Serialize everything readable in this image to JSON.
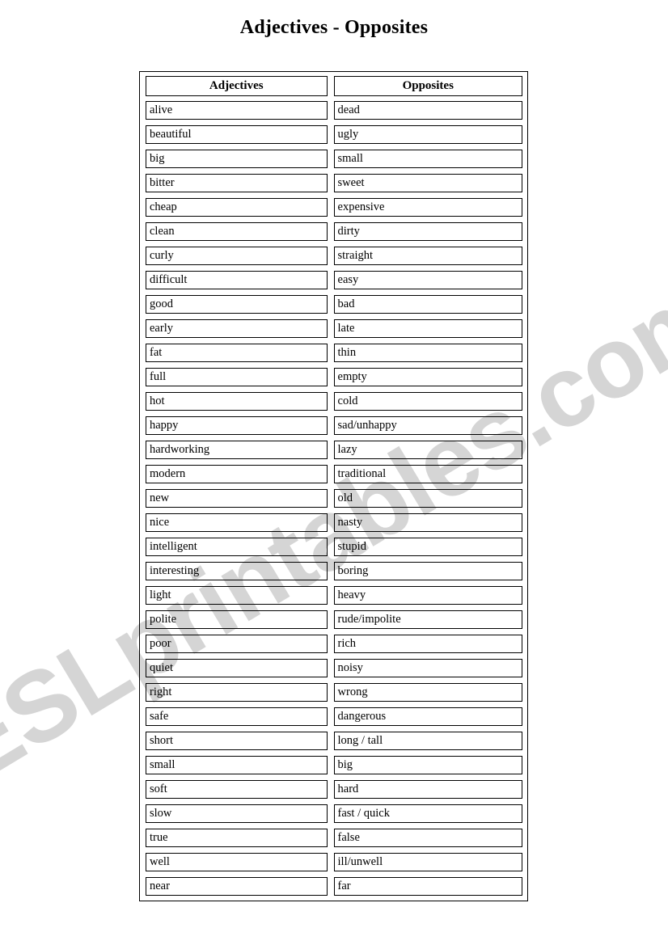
{
  "page": {
    "title": "Adjectives - Opposites"
  },
  "watermark": {
    "text": "ESLprintables.com",
    "color": "#d5d5d5"
  },
  "table": {
    "headers": {
      "left": "Adjectives",
      "right": "Opposites"
    },
    "rows": [
      {
        "adjective": "alive",
        "opposite": "dead"
      },
      {
        "adjective": "beautiful",
        "opposite": "ugly"
      },
      {
        "adjective": "big",
        "opposite": "small"
      },
      {
        "adjective": "bitter",
        "opposite": "sweet"
      },
      {
        "adjective": "cheap",
        "opposite": "expensive"
      },
      {
        "adjective": "clean",
        "opposite": "dirty"
      },
      {
        "adjective": "curly",
        "opposite": "straight"
      },
      {
        "adjective": "difficult",
        "opposite": "easy"
      },
      {
        "adjective": "good",
        "opposite": "bad"
      },
      {
        "adjective": "early",
        "opposite": "late"
      },
      {
        "adjective": "fat",
        "opposite": "thin"
      },
      {
        "adjective": "full",
        "opposite": "empty"
      },
      {
        "adjective": "hot",
        "opposite": "cold"
      },
      {
        "adjective": "happy",
        "opposite": "sad/unhappy"
      },
      {
        "adjective": "hardworking",
        "opposite": "lazy"
      },
      {
        "adjective": "modern",
        "opposite": "traditional"
      },
      {
        "adjective": "new",
        "opposite": "old"
      },
      {
        "adjective": "nice",
        "opposite": "nasty"
      },
      {
        "adjective": "intelligent",
        "opposite": "stupid"
      },
      {
        "adjective": "interesting",
        "opposite": "boring"
      },
      {
        "adjective": "light",
        "opposite": "heavy"
      },
      {
        "adjective": "polite",
        "opposite": "rude/impolite"
      },
      {
        "adjective": "poor",
        "opposite": "rich"
      },
      {
        "adjective": "quiet",
        "opposite": "noisy"
      },
      {
        "adjective": "right",
        "opposite": "wrong"
      },
      {
        "adjective": "safe",
        "opposite": "dangerous"
      },
      {
        "adjective": "short",
        "opposite": "long / tall"
      },
      {
        "adjective": "small",
        "opposite": "big"
      },
      {
        "adjective": "soft",
        "opposite": "hard"
      },
      {
        "adjective": "slow",
        "opposite": "fast / quick"
      },
      {
        "adjective": "true",
        "opposite": "false"
      },
      {
        "adjective": "well",
        "opposite": "ill/unwell"
      },
      {
        "adjective": "near",
        "opposite": "far"
      }
    ]
  }
}
